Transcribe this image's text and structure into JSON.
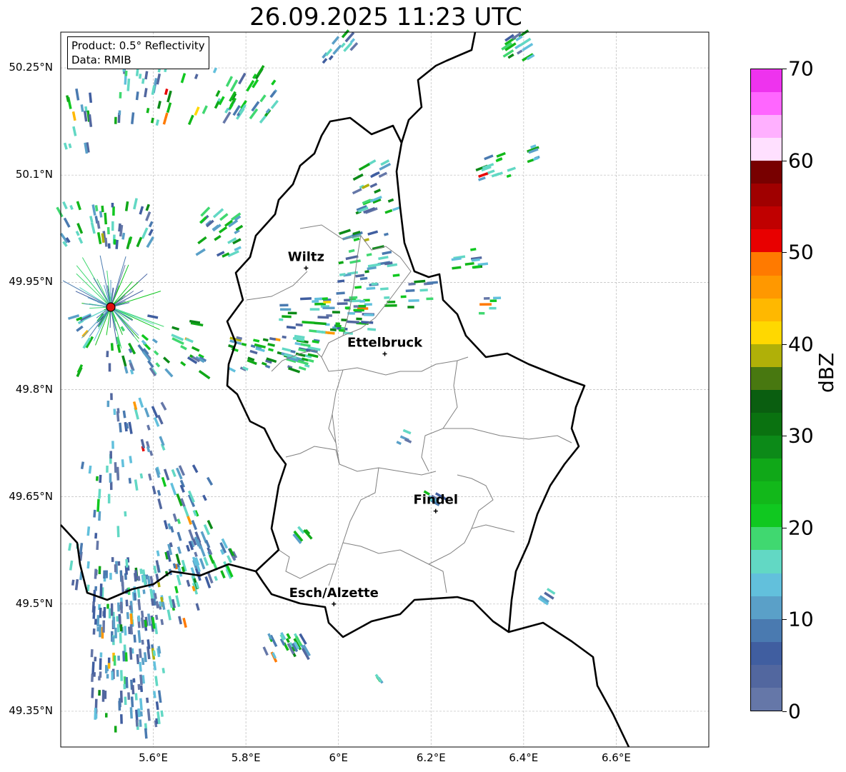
{
  "title": "26.09.2025 11:23 UTC",
  "info": {
    "product": "Product: 0.5° Reflectivity",
    "data": "Data: RMIB"
  },
  "axes": {
    "lat_ticks": [
      "50.25°N",
      "50.1°N",
      "49.95°N",
      "49.8°N",
      "49.65°N",
      "49.5°N",
      "49.35°N"
    ],
    "lon_ticks": [
      "5.6°E",
      "5.8°E",
      "6°E",
      "6.2°E",
      "6.4°E",
      "6.6°E"
    ],
    "lat_range": [
      49.3,
      50.3
    ],
    "lon_range": [
      5.4,
      6.8
    ]
  },
  "cities": [
    {
      "name": "Wiltz",
      "lon": 5.93,
      "lat": 49.97
    },
    {
      "name": "Ettelbruck",
      "lon": 6.1,
      "lat": 49.85
    },
    {
      "name": "Findel",
      "lon": 6.21,
      "lat": 49.63
    },
    {
      "name": "Esch/Alzette",
      "lon": 5.99,
      "lat": 49.5
    }
  ],
  "radar_site": {
    "lon": 5.51,
    "lat": 49.91,
    "color": "#e01010"
  },
  "colorbar": {
    "label": "dBZ",
    "min": 0,
    "max": 70,
    "step": 2.5,
    "ticks": [
      "0",
      "10",
      "20",
      "30",
      "40",
      "50",
      "60",
      "70"
    ],
    "colors": [
      "#6577a8",
      "#52679f",
      "#405ea0",
      "#4a7ab0",
      "#5aa0c8",
      "#62c0dc",
      "#62d8c4",
      "#40d870",
      "#10c820",
      "#12b81a",
      "#10a818",
      "#0c8a18",
      "#0a7210",
      "#0a5e10",
      "#487810",
      "#b0b008",
      "#ffd800",
      "#ffb800",
      "#ff9800",
      "#ff7a00",
      "#e80000",
      "#c00000",
      "#a00000",
      "#780000",
      "#ffe0ff",
      "#ffb0ff",
      "#ff66ff",
      "#ee33ee"
    ]
  }
}
